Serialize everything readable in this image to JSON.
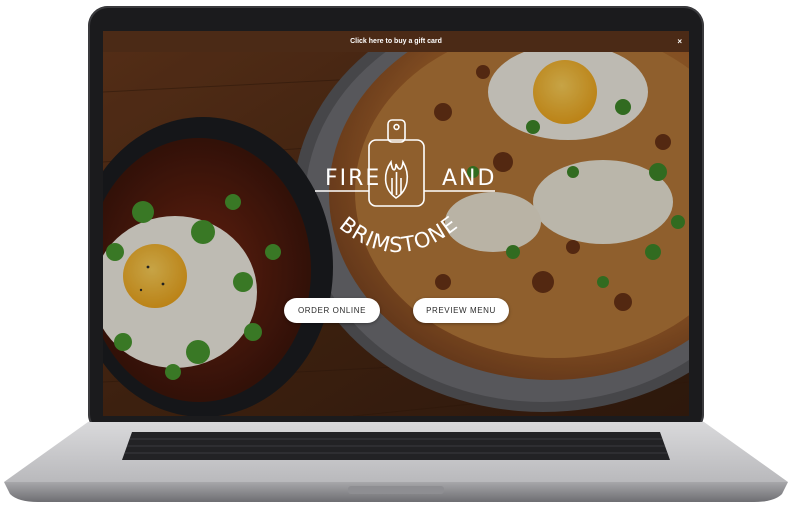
{
  "gift_bar": {
    "text": "Click here to buy a gift card",
    "close": "×"
  },
  "brand": {
    "word_left": "FIRE",
    "word_right": "AND",
    "word_arc": "BRIMSTONE"
  },
  "cta": {
    "order_online": "ORDER ONLINE",
    "preview_menu": "PREVIEW MENU"
  },
  "colors": {
    "gift_bar": "#4b2a16",
    "button_bg": "#ffffff",
    "button_text": "#2b2b2b",
    "wood": "#5a3219"
  },
  "icons": {
    "logo": "cutting-board-flame-icon"
  }
}
